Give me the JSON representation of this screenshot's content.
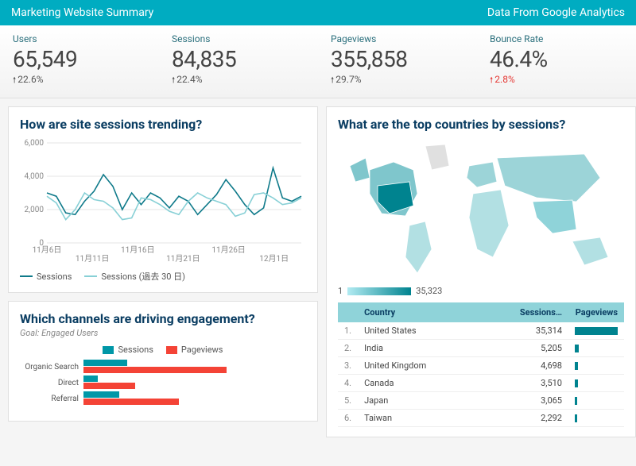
{
  "header": {
    "title": "Marketing Website Summary",
    "source": "Data From Google Analytics"
  },
  "kpis": [
    {
      "label": "Users",
      "value": "65,549",
      "delta": "22.6%",
      "neg": false
    },
    {
      "label": "Sessions",
      "value": "84,835",
      "delta": "22.4%",
      "neg": false
    },
    {
      "label": "Pageviews",
      "value": "355,858",
      "delta": "29.7%",
      "neg": false
    },
    {
      "label": "Bounce Rate",
      "value": "46.4%",
      "delta": "2.8%",
      "neg": true
    }
  ],
  "sessions_card": {
    "title": "How are site sessions trending?",
    "legend_a": "Sessions",
    "legend_b": "Sessions (過去 30 日)"
  },
  "countries_card": {
    "title": "What are the top countries by sessions?",
    "legend_min": "1",
    "legend_max": "35,323"
  },
  "channels_card": {
    "title": "Which channels are driving engagement?",
    "subtitle": "Goal: Engaged Users",
    "legend_a": "Sessions",
    "legend_b": "Pageviews"
  },
  "table": {
    "col_blank": "",
    "col_country": "Country",
    "col_sessions": "Sessions…",
    "col_pageviews": "Pageviews",
    "rows": [
      {
        "rank": "1.",
        "country": "United States",
        "sessions": "35,314",
        "pv_pct": 100
      },
      {
        "rank": "2.",
        "country": "India",
        "sessions": "5,205",
        "pv_pct": 9
      },
      {
        "rank": "3.",
        "country": "United Kingdom",
        "sessions": "4,698",
        "pv_pct": 8
      },
      {
        "rank": "4.",
        "country": "Canada",
        "sessions": "3,510",
        "pv_pct": 7
      },
      {
        "rank": "5.",
        "country": "Japan",
        "sessions": "3,065",
        "pv_pct": 6
      },
      {
        "rank": "6.",
        "country": "Taiwan",
        "sessions": "2,292",
        "pv_pct": 5
      }
    ]
  },
  "chart_data": [
    {
      "type": "line",
      "title": "How are site sessions trending?",
      "ylabel": "",
      "xlabel": "",
      "ylim": [
        0,
        6000
      ],
      "yticks": [
        0,
        2000,
        4000,
        6000
      ],
      "xticks": [
        "11月6日",
        "11月11日",
        "11月16日",
        "11月21日",
        "11月26日",
        "12月1日"
      ],
      "series": [
        {
          "name": "Sessions",
          "color": "#0f7a8a",
          "values": [
            3000,
            2800,
            1800,
            1700,
            2500,
            3100,
            4100,
            3400,
            2000,
            3000,
            2300,
            3000,
            2700,
            2100,
            2800,
            2500,
            1700,
            2300,
            2900,
            3800,
            3100,
            2300,
            1700,
            2100,
            4500,
            2700,
            2500,
            2800
          ]
        },
        {
          "name": "Sessions (過去 30 日)",
          "color": "#88d0d6",
          "values": [
            2800,
            2400,
            1400,
            2000,
            3000,
            2600,
            2500,
            2100,
            1400,
            1500,
            2700,
            2600,
            2300,
            1900,
            1700,
            2500,
            3000,
            2700,
            2500,
            2300,
            1600,
            1800,
            2900,
            3000,
            2700,
            2300,
            2400,
            2700
          ]
        }
      ]
    },
    {
      "type": "bar",
      "orientation": "horizontal",
      "title": "Which channels are driving engagement?",
      "categories": [
        "Organic Search",
        "Direct",
        "Referral"
      ],
      "series": [
        {
          "name": "Sessions",
          "color": "#0097a7",
          "values": [
            55,
            18,
            45
          ]
        },
        {
          "name": "Pageviews",
          "color": "#f44336",
          "values": [
            180,
            65,
            120
          ]
        }
      ]
    },
    {
      "type": "map",
      "title": "What are the top countries by sessions?",
      "scale_min": 1,
      "scale_max": 35323
    }
  ]
}
